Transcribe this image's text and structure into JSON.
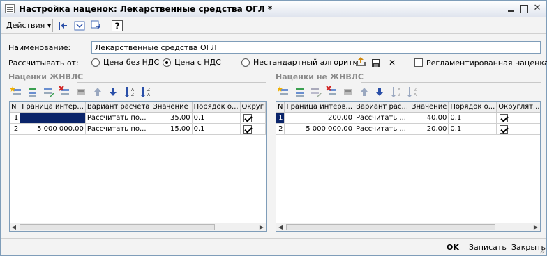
{
  "window": {
    "title": "Настройка наценок: Лекарственные средства ОГЛ *"
  },
  "toolbar": {
    "actions_label": "Действия",
    "buttons": [
      "arrow-left-icon",
      "refresh-icon",
      "navigate-icon",
      "help-icon"
    ]
  },
  "form": {
    "name_label": "Наименование:",
    "name_value": "Лекарственные средства ОГЛ",
    "calc_label": "Рассчитывать от:",
    "radio_no_vat": "Цена без НДС",
    "radio_with_vat": "Цена с НДС",
    "radio_nonstandard": "Нестандартный алгоритм",
    "selected_radio": "Цена с НДС",
    "regulated_label": "Регламентированная наценка",
    "regulated_checked": false
  },
  "left_section": {
    "title": "Наценки ЖНВЛС",
    "columns": [
      "N",
      "Граница интер...",
      "Вариант расчета",
      "Значение",
      "Порядок о...",
      "Округ"
    ],
    "rows": [
      {
        "n": "1",
        "border": "",
        "variant": "Рассчитать по...",
        "value": "35,00",
        "order": "0.1",
        "round": true
      },
      {
        "n": "2",
        "border": "5 000 000,00",
        "variant": "Рассчитать по...",
        "value": "15,00",
        "order": "0.1",
        "round": true
      }
    ]
  },
  "right_section": {
    "title": "Наценки не ЖНВЛС",
    "columns": [
      "N",
      "Граница интерв...",
      "Вариант рас...",
      "Значение",
      "Порядок о...",
      "Округлят..."
    ],
    "rows": [
      {
        "n": "1",
        "border": "200,00",
        "variant": "Рассчитать ...",
        "value": "40,00",
        "order": "0.1",
        "round": true
      },
      {
        "n": "2",
        "border": "5 000 000,00",
        "variant": "Рассчитать ...",
        "value": "20,00",
        "order": "0.1",
        "round": true
      }
    ]
  },
  "bottom": {
    "ok": "OK",
    "save": "Записать",
    "close": "Закрыть"
  },
  "colors": {
    "selection": "#0a246a",
    "border": "#7f9db9",
    "section_title": "#8a8a8a"
  }
}
